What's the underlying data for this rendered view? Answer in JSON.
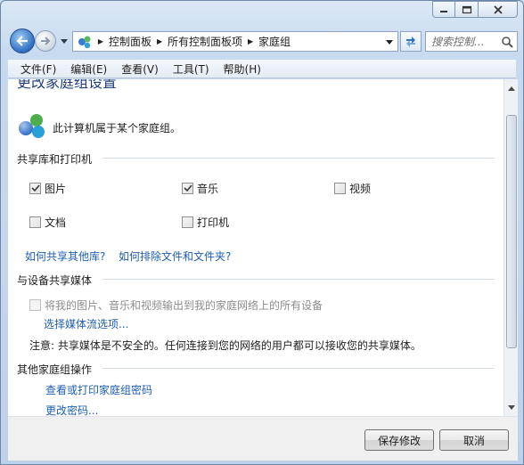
{
  "window": {
    "buttons": {
      "minimize": "minimize-icon",
      "maximize": "maximize-icon",
      "close": "close-icon"
    }
  },
  "nav": {
    "breadcrumb": [
      "控制面板",
      "所有控制面板项",
      "家庭组"
    ],
    "search_placeholder": "搜索控制..."
  },
  "menu": [
    "文件(F)",
    "编辑(E)",
    "查看(V)",
    "工具(T)",
    "帮助(H)"
  ],
  "content": {
    "page_title": "更改家庭组设置",
    "homegroup_status": "此计算机属于某个家庭组。",
    "share_libraries": {
      "header": "共享库和打印机",
      "items": [
        {
          "label": "图片",
          "checked": true
        },
        {
          "label": "音乐",
          "checked": true
        },
        {
          "label": "视频",
          "checked": false
        },
        {
          "label": "文档",
          "checked": false
        },
        {
          "label": "打印机",
          "checked": false
        }
      ],
      "links": [
        "如何共享其他库?",
        "如何排除文件和文件夹?"
      ]
    },
    "media": {
      "header": "与设备共享媒体",
      "option_label": "将我的图片、音乐和视频输出到我的家庭网络上的所有设备",
      "option_checked": false,
      "stream_link": "选择媒体流选项...",
      "note": "注意: 共享媒体是不安全的。任何连接到您的网络的用户都可以接收您的共享媒体。"
    },
    "other": {
      "header": "其他家庭组操作",
      "links": [
        "查看或打印家庭组密码",
        "更改密码..."
      ]
    }
  },
  "footer": {
    "save": "保存修改",
    "cancel": "取消"
  },
  "colors": {
    "link": "#1f5fb1",
    "title": "#1e3f7e"
  }
}
